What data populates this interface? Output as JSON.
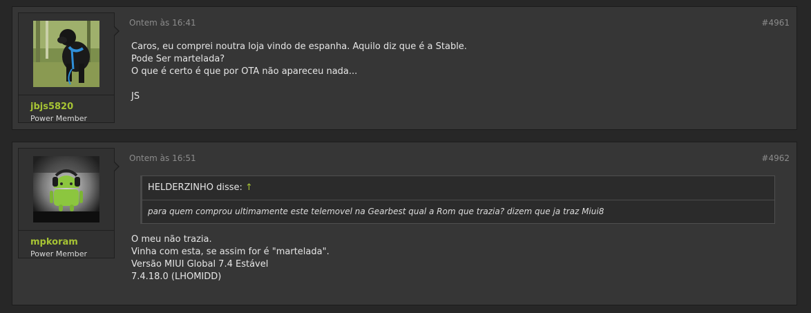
{
  "posts": [
    {
      "username": "jbjs5820",
      "user_title": "Power Member",
      "date": "Ontem às 16:41",
      "post_number": "#4961",
      "lines": [
        "Caros, eu comprei noutra loja vindo de espanha. Aquilo diz que é a Stable.",
        "Pode Ser martelada?",
        "O que é certo é que por OTA não apareceu nada...",
        "",
        "JS"
      ]
    },
    {
      "username": "mpkoram",
      "user_title": "Power Member",
      "date": "Ontem às 16:51",
      "post_number": "#4962",
      "quote": {
        "author_label": "HELDERZINHO disse:",
        "arrow_glyph": "↑",
        "text": "para quem comprou ultimamente este telemovel na Gearbest qual a Rom que trazia? dizem que ja traz Miui8"
      },
      "lines": [
        "O meu não trazia.",
        "Vinha com esta, se assim for é \"martelada\".",
        "Versão MIUI Global 7.4 Estável",
        "7.4.18.0 (LHOMIDD)"
      ]
    }
  ],
  "colors": {
    "username": "#a7c434",
    "background": "#272727",
    "post_background": "#363636"
  }
}
